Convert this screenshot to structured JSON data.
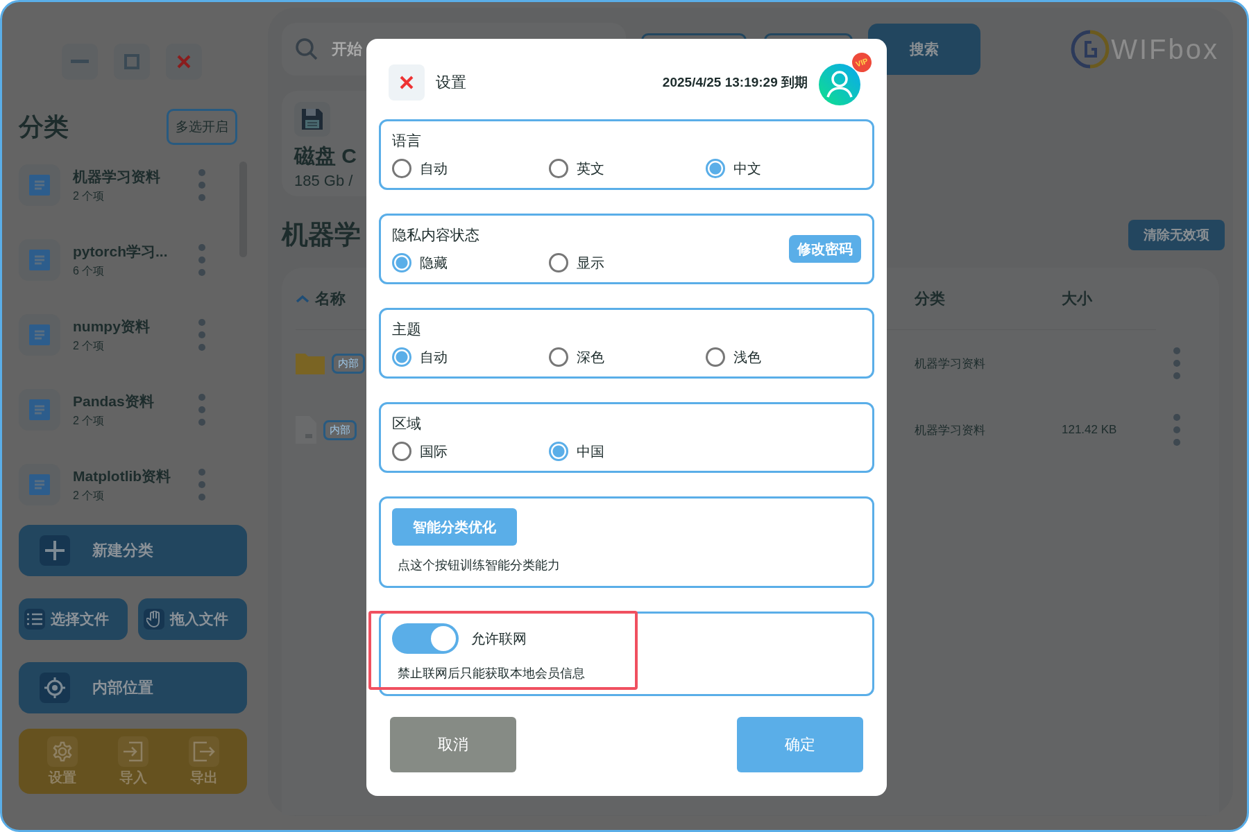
{
  "sidebar": {
    "title": "分类",
    "multi_select_button": "多选开启",
    "categories": [
      {
        "name": "机器学习资料",
        "count": "2 个项"
      },
      {
        "name": "pytorch学习...",
        "count": "6 个项"
      },
      {
        "name": "numpy资料",
        "count": "2 个项"
      },
      {
        "name": "Pandas资料",
        "count": "2 个项"
      },
      {
        "name": "Matplotlib资料",
        "count": "2 个项"
      }
    ],
    "new_category_button": "新建分类",
    "select_files_button": "选择文件",
    "drag_files_button": "拖入文件",
    "internal_location_button": "内部位置",
    "bottom_bar": [
      {
        "kind": "settings",
        "label": "设置"
      },
      {
        "kind": "import",
        "label": "导入"
      },
      {
        "kind": "export",
        "label": "导出"
      }
    ]
  },
  "main": {
    "search": {
      "placeholder": "开始"
    },
    "search_button": "搜索",
    "logo": "WIFbox",
    "disk": {
      "name": "磁盘 C",
      "usage": "185 Gb /"
    },
    "heading": "机器学",
    "clear_button": "清除无效项",
    "table": {
      "columns": [
        {
          "label": "名称",
          "sorted": true
        },
        {
          "label": "分类",
          "sorted": false
        },
        {
          "label": "大小",
          "sorted": false
        }
      ],
      "rows": [
        {
          "kind": "folder",
          "tag": "内部",
          "category": "机器学习资料"
        },
        {
          "kind": "file",
          "tag": "内部",
          "category": "机器学习资料",
          "size": "121.42 KB"
        }
      ]
    }
  },
  "dialog": {
    "title": "设置",
    "expiry": "2025/4/25 13:19:29 到期",
    "badge": "VIP",
    "sections": [
      {
        "kind": "radio",
        "title": "语言",
        "options": [
          {
            "label": "自动",
            "selected": false
          },
          {
            "label": "英文",
            "selected": false
          },
          {
            "label": "中文",
            "selected": true
          }
        ]
      },
      {
        "kind": "radio",
        "title": "隐私内容状态",
        "options": [
          {
            "label": "隐藏",
            "selected": true
          },
          {
            "label": "显示",
            "selected": false
          }
        ],
        "action_button": "修改密码"
      },
      {
        "kind": "radio",
        "title": "主题",
        "options": [
          {
            "label": "自动",
            "selected": true
          },
          {
            "label": "深色",
            "selected": false
          },
          {
            "label": "浅色",
            "selected": false
          }
        ]
      },
      {
        "kind": "radio",
        "title": "区域",
        "options": [
          {
            "label": "国际",
            "selected": false
          },
          {
            "label": "中国",
            "selected": true
          }
        ]
      },
      {
        "kind": "action",
        "button": "智能分类优化",
        "description": "点这个按钮训练智能分类能力"
      },
      {
        "kind": "toggle",
        "label": "允许联网",
        "on": true,
        "description": "禁止联网后只能获取本地会员信息",
        "highlighted": true
      }
    ],
    "cancel_button": "取消",
    "confirm_button": "确定"
  }
}
